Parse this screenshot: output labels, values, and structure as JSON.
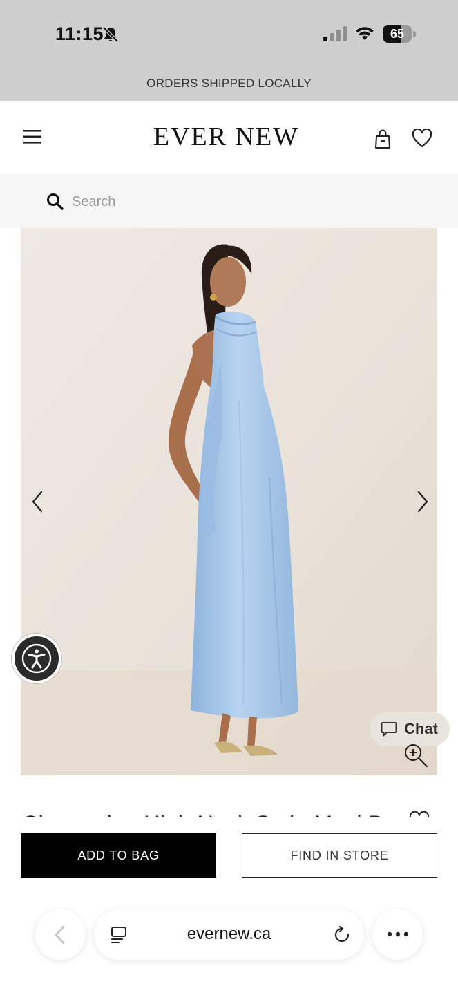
{
  "status_bar": {
    "time": "11:15",
    "battery": "65",
    "battery_level": 0.65,
    "icons": [
      "bell-slash-icon",
      "cellular-signal-icon",
      "wifi-icon",
      "battery-icon"
    ]
  },
  "announcement": "ORDERS SHIPPED LOCALLY",
  "header": {
    "logo": "EVER NEW",
    "icons": [
      "hamburger-menu-icon",
      "shopping-bag-icon",
      "heart-icon"
    ]
  },
  "search": {
    "placeholder": "Search",
    "value": ""
  },
  "product": {
    "title": "Clementine High Neck Satin Maxi Dress",
    "dress_color": "#a9c9eb",
    "background_color": "#ebe4dc"
  },
  "chat": {
    "label": "Chat"
  },
  "actions": {
    "add_to_bag": "ADD TO BAG",
    "find_in_store": "FIND IN STORE"
  },
  "browser": {
    "url": "evernew.ca"
  },
  "colors": {
    "status_bar_bg": "#cfcfcf",
    "search_bg": "#f6f6f6",
    "primary_button_bg": "#000000",
    "chat_bg": "#e9e4de"
  }
}
